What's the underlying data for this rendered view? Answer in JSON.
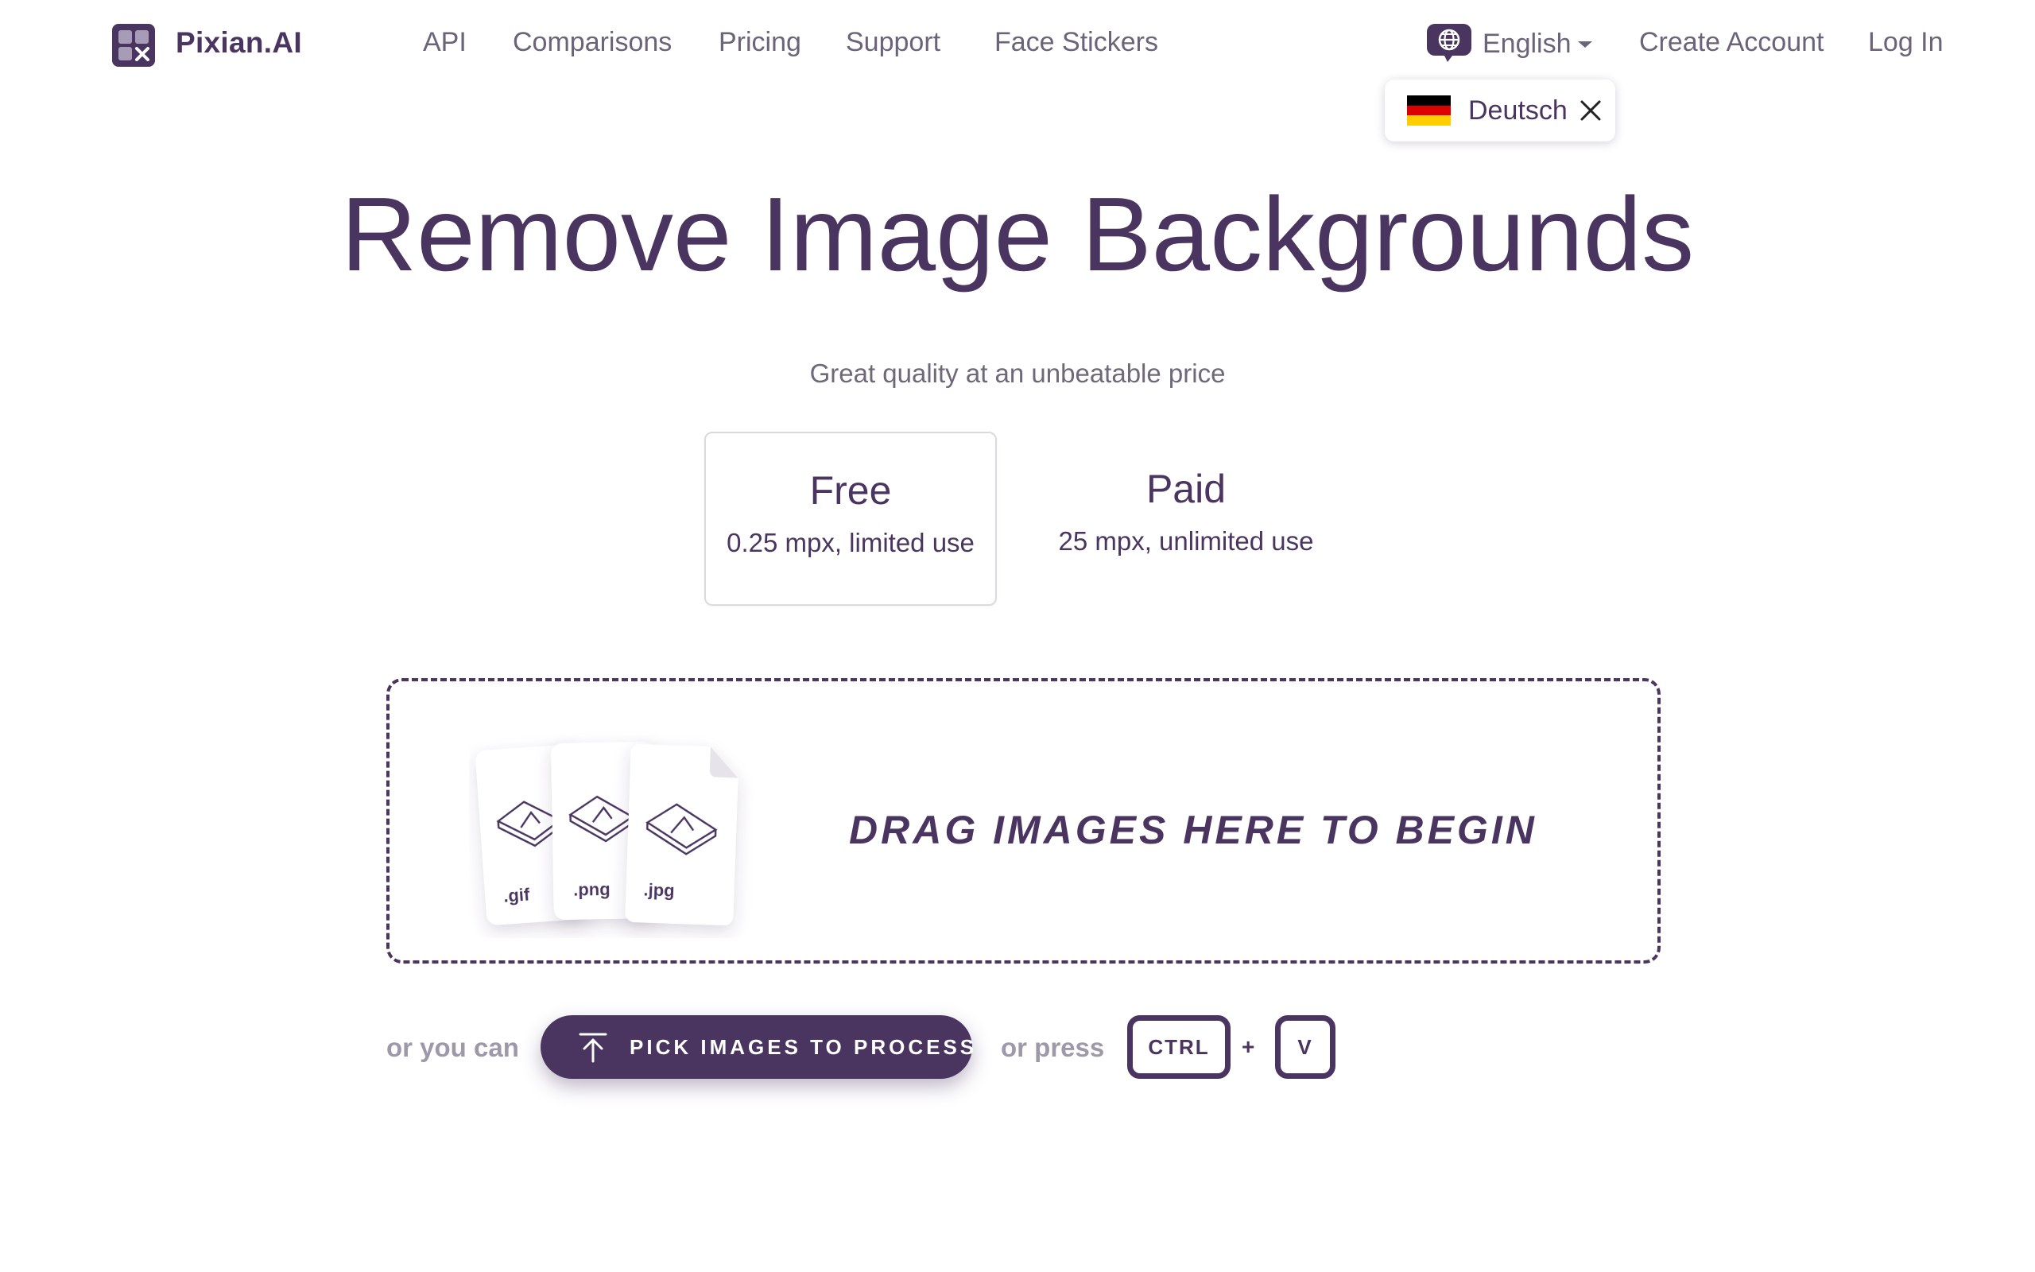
{
  "header": {
    "brand": "Pixian.AI",
    "logo_icon": "pixian-logo-icon",
    "nav": [
      {
        "label": "API"
      },
      {
        "label": "Comparisons"
      },
      {
        "label": "Pricing"
      },
      {
        "label": "Support"
      },
      {
        "label": "Face Stickers"
      }
    ],
    "language": {
      "label": "English",
      "icon": "globe-chat-icon"
    },
    "create_account": "Create Account",
    "log_in": "Log In"
  },
  "language_popup": {
    "label": "Deutsch",
    "flag_colors": [
      "#000000",
      "#dd0000",
      "#ffce00"
    ]
  },
  "hero": {
    "title": "Remove Image Backgrounds",
    "subtitle": "Great quality at an unbeatable price"
  },
  "plans": [
    {
      "name": "Free",
      "desc": "0.25 mpx, limited use",
      "selected": true
    },
    {
      "name": "Paid",
      "desc": "25 mpx, unlimited use",
      "selected": false
    }
  ],
  "dropzone": {
    "text": "DRAG IMAGES HERE TO BEGIN",
    "file_types": [
      ".gif",
      ".png",
      ".jpg"
    ]
  },
  "actions": {
    "or_you_can": "or you can",
    "pick_button": "PICK IMAGES TO PROCESS",
    "or_press": "or press",
    "key_ctrl": "CTRL",
    "plus": "+",
    "key_v": "V"
  },
  "colors": {
    "brand": "#4a3560",
    "muted": "#6b6478"
  }
}
